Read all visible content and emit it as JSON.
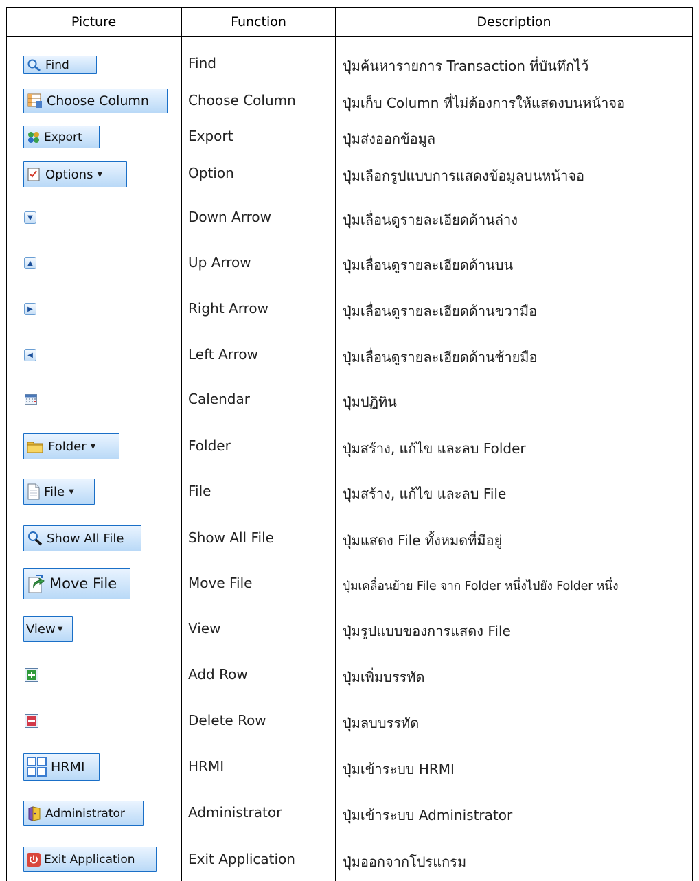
{
  "headers": {
    "picture": "Picture",
    "function": "Function",
    "description": "Description"
  },
  "rows": [
    {
      "button": "Find",
      "function": "Find",
      "description": "ปุ่มค้นหารายการ Transaction ที่บันทึกไว้"
    },
    {
      "button": "Choose Column",
      "function": "Choose Column",
      "description": "ปุ่มเก็บ Column ที่ไม่ต้องการให้แสดงบนหน้าจอ"
    },
    {
      "button": "Export",
      "function": "Export",
      "description": "ปุ่มส่งออกข้อมูล"
    },
    {
      "button": "Options",
      "function": "Option",
      "description": "ปุ่มเลือกรูปแบบการแสดงข้อมูลบนหน้าจอ"
    },
    {
      "button": "",
      "function": "Down Arrow",
      "description": "ปุ่มเลื่อนดูรายละเอียดด้านล่าง"
    },
    {
      "button": "",
      "function": "Up Arrow",
      "description": "ปุ่มเลื่อนดูรายละเอียดด้านบน"
    },
    {
      "button": "",
      "function": "Right Arrow",
      "description": "ปุ่มเลื่อนดูรายละเอียดด้านขวามือ"
    },
    {
      "button": "",
      "function": "Left Arrow",
      "description": "ปุ่มเลื่อนดูรายละเอียดด้านซ้ายมือ"
    },
    {
      "button": "",
      "function": "Calendar",
      "description": "ปุ่มปฏิทิน"
    },
    {
      "button": "Folder",
      "function": "Folder",
      "description": "ปุ่มสร้าง, แก้ไข และลบ Folder"
    },
    {
      "button": "File",
      "function": "File",
      "description": "ปุ่มสร้าง, แก้ไข และลบ File"
    },
    {
      "button": "Show All File",
      "function": "Show All File",
      "description": "ปุ่มแสดง File ทั้งหมดที่มีอยู่"
    },
    {
      "button": "Move File",
      "function": "Move File",
      "description": "ปุ่มเคลื่อนย้าย File จาก Folder หนึ่งไปยัง Folder หนึ่ง"
    },
    {
      "button": "View",
      "function": "View",
      "description": "ปุ่มรูปแบบของการแสดง File"
    },
    {
      "button": "",
      "function": "Add Row",
      "description": "ปุ่มเพิ่มบรรทัด"
    },
    {
      "button": "",
      "function": "Delete Row",
      "description": "ปุ่มลบบรรทัด"
    },
    {
      "button": "HRMI",
      "function": "HRMI",
      "description": "ปุ่มเข้าระบบ HRMI"
    },
    {
      "button": "Administrator",
      "function": "Administrator",
      "description": "ปุ่มเข้าระบบ  Administrator"
    },
    {
      "button": "Exit Application",
      "function": "Exit Application",
      "description": "ปุ่มออกจากโปรแกรม"
    }
  ]
}
